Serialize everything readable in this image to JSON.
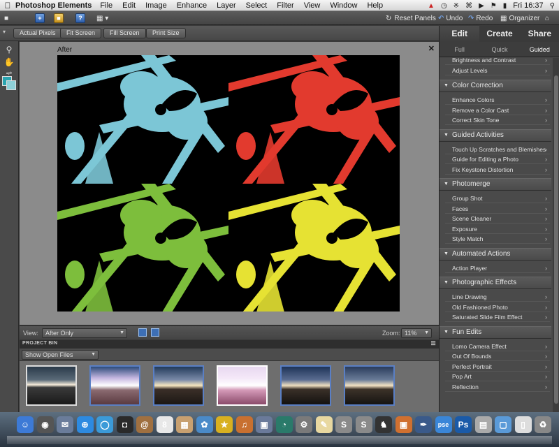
{
  "menubar": {
    "app_name": "Photoshop Elements",
    "menus": [
      "File",
      "Edit",
      "Image",
      "Enhance",
      "Layer",
      "Select",
      "Filter",
      "View",
      "Window",
      "Help"
    ],
    "clock": "Fri 16:37"
  },
  "appbar": {
    "reset_panels": "Reset Panels",
    "undo": "Undo",
    "redo": "Redo",
    "organizer": "Organizer"
  },
  "options": {
    "actual_pixels": "Actual Pixels",
    "fit_screen": "Fit Screen",
    "fill_screen": "Fill Screen",
    "print_size": "Print Size"
  },
  "document": {
    "title": "After",
    "close": "✕",
    "colors": [
      "#7cc6d6",
      "#e23a2e",
      "#7dbe3c",
      "#e6e233"
    ]
  },
  "viewbar": {
    "view_label": "View:",
    "view_value": "After Only",
    "zoom_label": "Zoom:",
    "zoom_value": "11%"
  },
  "bin": {
    "header": "PROJECT BIN",
    "show_value": "Show Open Files"
  },
  "panel": {
    "tabs": [
      "Edit",
      "Create",
      "Share"
    ],
    "subtabs": [
      "Full",
      "Quick",
      "Guided"
    ],
    "partial_items": [
      "Brightness and Contrast",
      "Adjust Levels"
    ],
    "sections": [
      {
        "title": "Color Correction",
        "items": [
          "Enhance Colors",
          "Remove a Color Cast",
          "Correct Skin Tone"
        ]
      },
      {
        "title": "Guided Activities",
        "items": [
          "Touch Up Scratches and Blemishes",
          "Guide for Editing a Photo",
          "Fix Keystone Distortion"
        ]
      },
      {
        "title": "Photomerge",
        "items": [
          "Group Shot",
          "Faces",
          "Scene Cleaner",
          "Exposure",
          "Style Match"
        ]
      },
      {
        "title": "Automated Actions",
        "items": [
          "Action Player"
        ]
      },
      {
        "title": "Photographic Effects",
        "items": [
          "Line Drawing",
          "Old Fashioned Photo",
          "Saturated Slide Film Effect"
        ]
      },
      {
        "title": "Fun Edits",
        "items": [
          "Lomo Camera Effect",
          "Out Of Bounds",
          "Perfect Portrait",
          "Pop Art",
          "Reflection"
        ]
      }
    ]
  },
  "dock": {
    "labels": [
      "pse",
      "Ps"
    ]
  }
}
